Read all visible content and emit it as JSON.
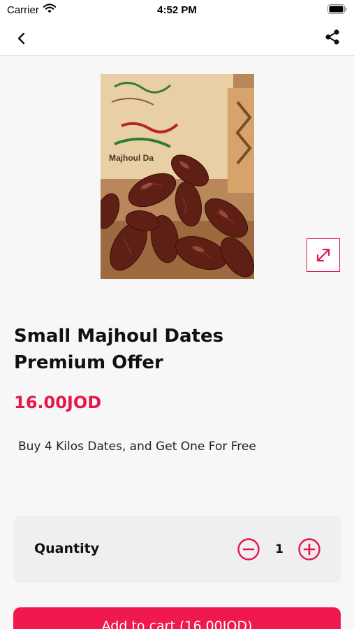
{
  "status_bar": {
    "carrier": "Carrier",
    "time": "4:52 PM"
  },
  "navbar": {
    "back_icon": "chevron-left-icon",
    "share_icon": "share-icon"
  },
  "product": {
    "image_alt": "Majhoul dates",
    "image_box_text": "Majhoul Da",
    "title": "Small Majhoul Dates Premium Offer",
    "price": "16.00JOD",
    "description": "Buy 4 Kilos Dates, and Get One For Free"
  },
  "quantity": {
    "label": "Quantity",
    "value": "1",
    "minus_icon": "minus-circle-icon",
    "plus_icon": "plus-circle-icon"
  },
  "cart": {
    "add_label": "Add to cart (16.00JOD)"
  },
  "colors": {
    "accent": "#e5174a",
    "button": "#f0194e",
    "card": "#efeff1",
    "background": "#f7f7f8"
  }
}
